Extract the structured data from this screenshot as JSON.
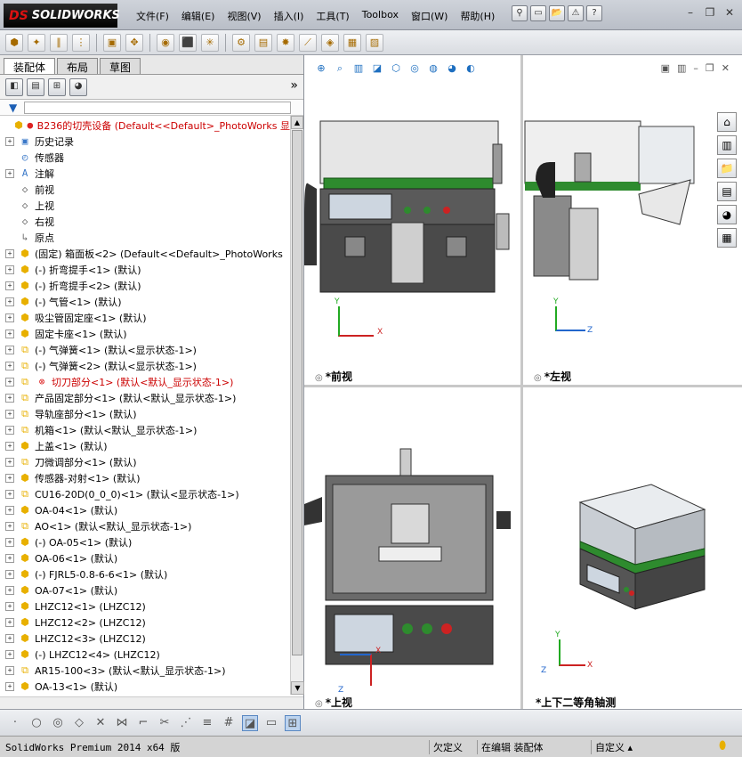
{
  "app": {
    "brand": "SOLIDWORKS",
    "brand_prefix": "DS"
  },
  "menu": [
    "文件(F)",
    "编辑(E)",
    "视图(V)",
    "插入(I)",
    "工具(T)",
    "Toolbox",
    "窗口(W)",
    "帮助(H)"
  ],
  "tabs": [
    "装配体",
    "布局",
    "草图"
  ],
  "tree": {
    "root": "B236的切壳设备  (Default<<Default>_PhotoWorks 显",
    "items": [
      {
        "label": "历史记录",
        "icon": "folder",
        "exp": true
      },
      {
        "label": "传感器",
        "icon": "sensor",
        "exp": false
      },
      {
        "label": "注解",
        "icon": "annot",
        "exp": true
      },
      {
        "label": "前视",
        "icon": "plane",
        "exp": false
      },
      {
        "label": "上视",
        "icon": "plane",
        "exp": false
      },
      {
        "label": "右视",
        "icon": "plane",
        "exp": false
      },
      {
        "label": "原点",
        "icon": "origin",
        "exp": false
      },
      {
        "label": "(固定) 箱面板<2> (Default<<Default>_PhotoWorks",
        "icon": "part",
        "exp": true
      },
      {
        "label": "(-) 折弯提手<1> (默认)",
        "icon": "part",
        "exp": true
      },
      {
        "label": "(-) 折弯提手<2> (默认)",
        "icon": "part",
        "exp": true
      },
      {
        "label": "(-) 气管<1> (默认)",
        "icon": "part",
        "exp": true
      },
      {
        "label": "吸尘管固定座<1> (默认)",
        "icon": "part",
        "exp": true
      },
      {
        "label": "固定卡座<1> (默认)",
        "icon": "part",
        "exp": true
      },
      {
        "label": "(-) 气弹簧<1> (默认<显示状态-1>)",
        "icon": "asm",
        "exp": true
      },
      {
        "label": "(-) 气弹簧<2> (默认<显示状态-1>)",
        "icon": "asm",
        "exp": true
      },
      {
        "label": "切刀部分<1> (默认<默认_显示状态-1>)",
        "icon": "asm-err",
        "exp": true,
        "red": true
      },
      {
        "label": "产品固定部分<1> (默认<默认_显示状态-1>)",
        "icon": "asm",
        "exp": true
      },
      {
        "label": "导轨座部分<1> (默认)",
        "icon": "asm",
        "exp": true
      },
      {
        "label": "机箱<1> (默认<默认_显示状态-1>)",
        "icon": "asm",
        "exp": true
      },
      {
        "label": "上盖<1> (默认)",
        "icon": "part",
        "exp": true
      },
      {
        "label": "刀微调部分<1> (默认)",
        "icon": "asm",
        "exp": true
      },
      {
        "label": "传感器-对射<1> (默认)",
        "icon": "part",
        "exp": true
      },
      {
        "label": "CU16-20D(0_0_0)<1> (默认<显示状态-1>)",
        "icon": "asm",
        "exp": true
      },
      {
        "label": "OA-04<1> (默认)",
        "icon": "part",
        "exp": true
      },
      {
        "label": "AO<1> (默认<默认_显示状态-1>)",
        "icon": "asm",
        "exp": true
      },
      {
        "label": "(-) OA-05<1> (默认)",
        "icon": "part",
        "exp": true
      },
      {
        "label": "OA-06<1> (默认)",
        "icon": "part",
        "exp": true
      },
      {
        "label": "(-) FJRL5-0.8-6-6<1> (默认)",
        "icon": "part",
        "exp": true
      },
      {
        "label": "OA-07<1> (默认)",
        "icon": "part",
        "exp": true
      },
      {
        "label": "LHZC12<1> (LHZC12)",
        "icon": "part",
        "exp": true
      },
      {
        "label": "LHZC12<2> (LHZC12)",
        "icon": "part",
        "exp": true
      },
      {
        "label": "LHZC12<3> (LHZC12)",
        "icon": "part",
        "exp": true
      },
      {
        "label": "(-) LHZC12<4> (LHZC12)",
        "icon": "part",
        "exp": true
      },
      {
        "label": "AR15-100<3> (默认<默认_显示状态-1>)",
        "icon": "asm",
        "exp": true
      },
      {
        "label": "OA-13<1> (默认)",
        "icon": "part",
        "exp": true
      }
    ]
  },
  "views": {
    "front": "*前视",
    "left": "*左视",
    "top": "*上视",
    "iso": "*上下二等角轴测"
  },
  "status": {
    "product": "SolidWorks Premium 2014 x64 版",
    "defined": "欠定义",
    "editing": "在编辑 装配体",
    "custom": "自定义"
  },
  "colors": {
    "green": "#2e8b2e",
    "dark": "#4a4a4a",
    "accent": "#1e6fc0"
  }
}
